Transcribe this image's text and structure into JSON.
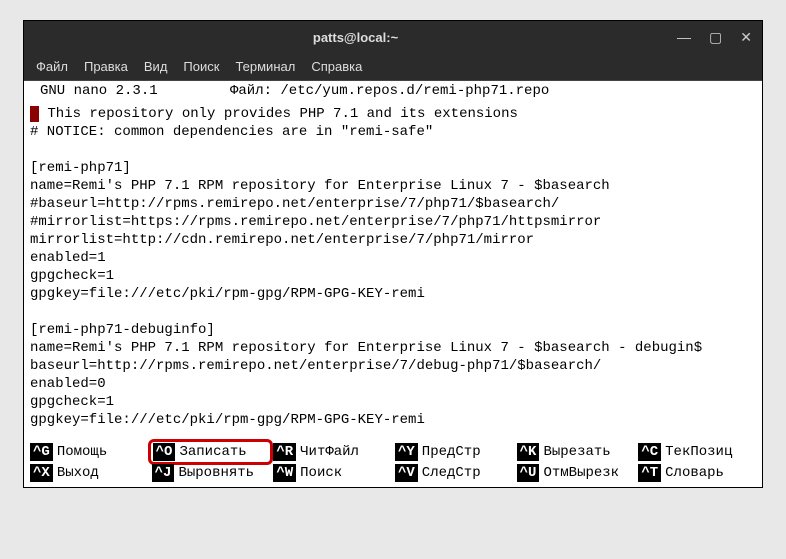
{
  "titlebar": {
    "title": "patts@local:~"
  },
  "menubar": {
    "file": "Файл",
    "edit": "Правка",
    "view": "Вид",
    "search": "Поиск",
    "terminal": "Терминал",
    "help": "Справка"
  },
  "nano_header": {
    "app": "GNU nano  2.3.1",
    "file_label": "Файл: /etc/yum.repos.d/remi-php71.repo"
  },
  "file_lines": [
    " This repository only provides PHP 7.1 and its extensions",
    "# NOTICE: common dependencies are in \"remi-safe\"",
    "",
    "[remi-php71]",
    "name=Remi's PHP 7.1 RPM repository for Enterprise Linux 7 - $basearch",
    "#baseurl=http://rpms.remirepo.net/enterprise/7/php71/$basearch/",
    "#mirrorlist=https://rpms.remirepo.net/enterprise/7/php71/httpsmirror",
    "mirrorlist=http://cdn.remirepo.net/enterprise/7/php71/mirror",
    "enabled=1",
    "gpgcheck=1",
    "gpgkey=file:///etc/pki/rpm-gpg/RPM-GPG-KEY-remi",
    "",
    "[remi-php71-debuginfo]",
    "name=Remi's PHP 7.1 RPM repository for Enterprise Linux 7 - $basearch - debugin$",
    "baseurl=http://rpms.remirepo.net/enterprise/7/debug-php71/$basearch/",
    "enabled=0",
    "gpgcheck=1",
    "gpgkey=file:///etc/pki/rpm-gpg/RPM-GPG-KEY-remi"
  ],
  "shortcuts": {
    "row1": [
      {
        "key": "^G",
        "label": "Помощь"
      },
      {
        "key": "^O",
        "label": "Записать"
      },
      {
        "key": "^R",
        "label": "ЧитФайл"
      },
      {
        "key": "^Y",
        "label": "ПредСтр"
      },
      {
        "key": "^K",
        "label": "Вырезать"
      },
      {
        "key": "^C",
        "label": "ТекПозиц"
      }
    ],
    "row2": [
      {
        "key": "^X",
        "label": "Выход"
      },
      {
        "key": "^J",
        "label": "Выровнять"
      },
      {
        "key": "^W",
        "label": "Поиск"
      },
      {
        "key": "^V",
        "label": "СледСтр"
      },
      {
        "key": "^U",
        "label": "ОтмВырезк"
      },
      {
        "key": "^T",
        "label": "Словарь"
      }
    ]
  }
}
